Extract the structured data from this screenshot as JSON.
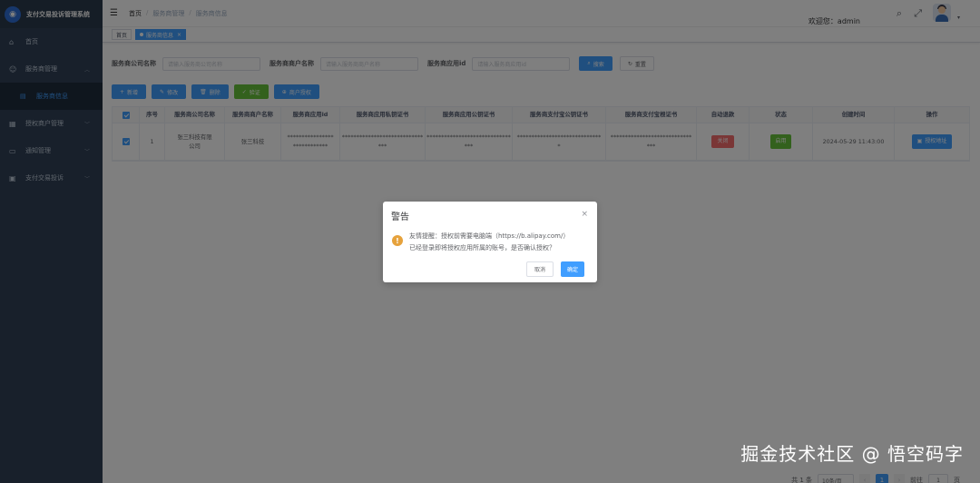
{
  "sidebar": {
    "logo_title": "支付交易投诉管理系统",
    "items": [
      {
        "label": "首页",
        "icon": "dashboard-icon"
      },
      {
        "label": "服务商管理",
        "icon": "user-group-icon"
      },
      {
        "label": "服务商信息",
        "icon": "list-icon",
        "active": true
      },
      {
        "label": "授权商户管理",
        "icon": "document-icon"
      },
      {
        "label": "通知管理",
        "icon": "message-icon"
      },
      {
        "label": "支付交易投诉",
        "icon": "monitor-icon"
      }
    ]
  },
  "header": {
    "breadcrumb": [
      "首页",
      "服务商管理",
      "服务商信息"
    ],
    "welcome": "欢迎您：admin"
  },
  "tags": [
    {
      "label": "首页",
      "active": false
    },
    {
      "label": "服务商信息",
      "active": true
    }
  ],
  "search": {
    "company_label": "服务商公司名称",
    "company_placeholder": "请输入服务商公司名称",
    "merchant_label": "服务商商户名称",
    "merchant_placeholder": "请输入服务商商户名称",
    "appid_label": "服务商应用id",
    "appid_placeholder": "请输入服务商应用id",
    "search_btn": "搜索",
    "reset_btn": "重置"
  },
  "toolbar": {
    "add": "新增",
    "edit": "修改",
    "delete": "删除",
    "verify": "验证",
    "authorize": "商户授权"
  },
  "table": {
    "headers": [
      "序号",
      "服务商公司名称",
      "服务商商户名称",
      "服务商应用id",
      "服务商应用私钥证书",
      "服务商应用公钥证书",
      "服务商支付宝公钥证书",
      "服务商支付宝根证书",
      "自动退款",
      "状态",
      "创建时间",
      "操作"
    ],
    "rows": [
      {
        "index": "1",
        "company_l1": "张三科技有限",
        "company_l2": "公司",
        "merchant": "张三科技",
        "appid_l1": "****************",
        "appid_l2": "************",
        "private_l1": "****************************",
        "private_l2": "***",
        "public_l1": "*****************************",
        "public_l2": "***",
        "alipay_pub_l1": "*****************************",
        "alipay_pub_l2": "*",
        "alipay_root_l1": "****************************",
        "alipay_root_l2": "***",
        "refund": "关闭",
        "status": "启用",
        "created": "2024-05-29 11:43:00",
        "action": "授权地址"
      }
    ]
  },
  "pagination": {
    "total": "共 1 条",
    "page_size": "10条/页",
    "current": "1",
    "goto_label": "前往",
    "goto_value": "1",
    "page_suffix": "页"
  },
  "dialog": {
    "title": "警告",
    "line1": "友情提醒：授权前需要电脑端（https://b.alipay.com/）",
    "line2": "已经登录即将授权应用所属的账号，是否确认授权？",
    "cancel": "取消",
    "confirm": "确定"
  },
  "watermark": "掘金技术社区 @ 悟空码字",
  "colors": {
    "sidebar": "#304156",
    "primary": "#409eff",
    "success": "#67c23a",
    "danger": "#f56c6c",
    "warning": "#e6a23c"
  }
}
